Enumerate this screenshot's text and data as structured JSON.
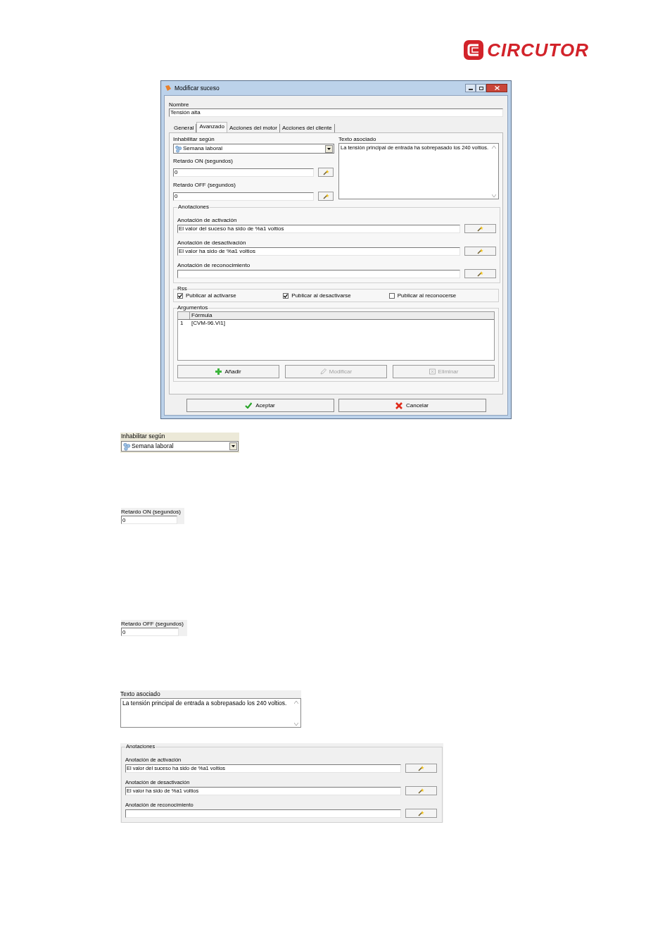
{
  "logo": {
    "text": "CIRCUTOR"
  },
  "dialog": {
    "title": "Modificar suceso",
    "name_label": "Nombre",
    "name_value": "Tensión alta",
    "tabs": [
      {
        "label": "General",
        "selected": false
      },
      {
        "label": "Avanzado",
        "selected": true
      },
      {
        "label": "Acciones del motor",
        "selected": false
      },
      {
        "label": "Acciones del cliente",
        "selected": false
      }
    ],
    "disable_label": "Inhabilitar según",
    "disable_value": "Semana laboral",
    "delay_on_label": "Retardo ON (segundos)",
    "delay_on_value": "0",
    "delay_off_label": "Retardo OFF (segundos)",
    "delay_off_value": "0",
    "text_label": "Texto asociado",
    "text_value": "La tensión principal de entrada ha sobrepasado los 240 voltios.",
    "annotations": {
      "title": "Anotaciones",
      "fields": [
        {
          "label": "Anotación de activación",
          "value": "El valor del suceso  ha sido de %a1 voltios"
        },
        {
          "label": "Anotación de desactivación",
          "value": "El valor ha sido de %a1 voltios"
        },
        {
          "label": "Anotación de reconocimiento"
        }
      ]
    },
    "rss": {
      "title": "Rss",
      "options": [
        {
          "label": "Publicar al activarse",
          "checked": true
        },
        {
          "label": "Publicar al desactivarse",
          "checked": true
        },
        {
          "label": "Publicar al reconocerse",
          "checked": false
        }
      ]
    },
    "arguments": {
      "title": "Argumentos",
      "column": "Fórmula",
      "rows": [
        {
          "index": "1",
          "formula": "[CVM-96.VI1]"
        }
      ],
      "buttons": [
        {
          "label": "Añadir",
          "kind": "add",
          "disabled": false
        },
        {
          "label": "Modificar",
          "kind": "edit",
          "disabled": true
        },
        {
          "label": "Eliminar",
          "kind": "delete",
          "disabled": true
        }
      ]
    },
    "buttons": [
      {
        "label": "Aceptar",
        "kind": "ok"
      },
      {
        "label": "Cancelar",
        "kind": "cancel"
      }
    ]
  },
  "snippets": {
    "disable": {
      "label": "Inhabilitar según",
      "value": "Semana laboral"
    },
    "delay_on": {
      "label": "Retardo ON (segundos)",
      "value": "0"
    },
    "delay_off": {
      "label": "Retardo OFF (segundos)",
      "value": "0"
    },
    "text": {
      "label": "Texto asociado",
      "value": "La tensión principal de entrada a sobrepasado los 240 voltios."
    },
    "annotations": {
      "title": "Anotaciones",
      "fields": [
        {
          "label": "Anotación de activación",
          "value": "El valor del suceso  ha sido de %a1 voltios"
        },
        {
          "label": "Anotación de desactivación",
          "value": "El valor ha sido de %a1 voltios"
        },
        {
          "label": "Anotación de reconocimiento"
        }
      ]
    }
  }
}
